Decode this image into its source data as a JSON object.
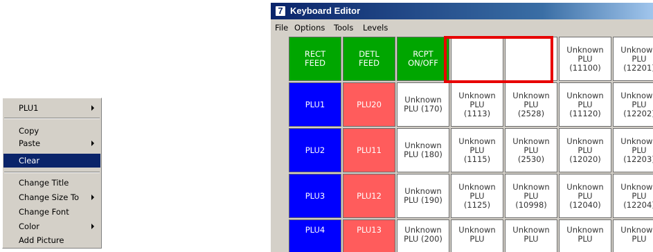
{
  "context_menu": {
    "items": [
      {
        "label": "PLU1",
        "submenu": true
      },
      {
        "label": "Copy",
        "submenu": false
      },
      {
        "label": "Paste",
        "submenu": true
      },
      {
        "label": "Clear",
        "submenu": false,
        "selected": true
      },
      {
        "label": "Change Title",
        "submenu": false
      },
      {
        "label": "Change Size To",
        "submenu": true
      },
      {
        "label": "Change Font",
        "submenu": false
      },
      {
        "label": "Color",
        "submenu": true
      },
      {
        "label": "Add Picture",
        "submenu": false
      }
    ]
  },
  "window": {
    "icon_glyph": "7",
    "title": "Keyboard Editor",
    "menu": [
      {
        "label": "File"
      },
      {
        "label": "Options"
      },
      {
        "label": "Tools"
      },
      {
        "label": "Levels"
      }
    ]
  },
  "keyboard": {
    "colors": {
      "green": "#00a600",
      "blue": "#0000ff",
      "red": "#ff5c5c",
      "white": "#ffffff",
      "highlight": "#e80000"
    },
    "rows": [
      [
        {
          "label": "RECT\nFEED",
          "color": "green"
        },
        {
          "label": "DETL\nFEED",
          "color": "green"
        },
        {
          "label": "RCPT\nON/OFF",
          "color": "green"
        },
        {
          "label": "",
          "color": "white"
        },
        {
          "label": "",
          "color": "white"
        },
        {
          "label": "Unknown\nPLU\n(11100)",
          "color": "white"
        },
        {
          "label": "Unknown\nPLU\n(12201)",
          "color": "white"
        }
      ],
      [
        {
          "label": "PLU1",
          "color": "blue"
        },
        {
          "label": "PLU20",
          "color": "red"
        },
        {
          "label": "Unknown\nPLU (170)",
          "color": "white"
        },
        {
          "label": "Unknown\nPLU\n(1113)",
          "color": "white"
        },
        {
          "label": "Unknown\nPLU\n(2528)",
          "color": "white"
        },
        {
          "label": "Unknown\nPLU\n(11120)",
          "color": "white"
        },
        {
          "label": "Unknown\nPLU\n(12202)",
          "color": "white"
        }
      ],
      [
        {
          "label": "PLU2",
          "color": "blue"
        },
        {
          "label": "PLU11",
          "color": "red"
        },
        {
          "label": "Unknown\nPLU (180)",
          "color": "white"
        },
        {
          "label": "Unknown\nPLU\n(1115)",
          "color": "white"
        },
        {
          "label": "Unknown\nPLU\n(2530)",
          "color": "white"
        },
        {
          "label": "Unknown\nPLU\n(12020)",
          "color": "white"
        },
        {
          "label": "Unknown\nPLU\n(12203)",
          "color": "white"
        }
      ],
      [
        {
          "label": "PLU3",
          "color": "blue"
        },
        {
          "label": "PLU12",
          "color": "red"
        },
        {
          "label": "Unknown\nPLU (190)",
          "color": "white"
        },
        {
          "label": "Unknown\nPLU\n(1125)",
          "color": "white"
        },
        {
          "label": "Unknown\nPLU\n(10998)",
          "color": "white"
        },
        {
          "label": "Unknown\nPLU\n(12040)",
          "color": "white"
        },
        {
          "label": "Unknown\nPLU\n(12204)",
          "color": "white"
        }
      ],
      [
        {
          "label": "PLU4",
          "color": "blue"
        },
        {
          "label": "PLU13",
          "color": "red"
        },
        {
          "label": "Unknown\nPLU (200)",
          "color": "white"
        },
        {
          "label": "Unknown\nPLU",
          "color": "white"
        },
        {
          "label": "Unknown\nPLU",
          "color": "white"
        },
        {
          "label": "Unknown\nPLU",
          "color": "white"
        },
        {
          "label": "Unknown\nPLU",
          "color": "white"
        }
      ]
    ]
  }
}
